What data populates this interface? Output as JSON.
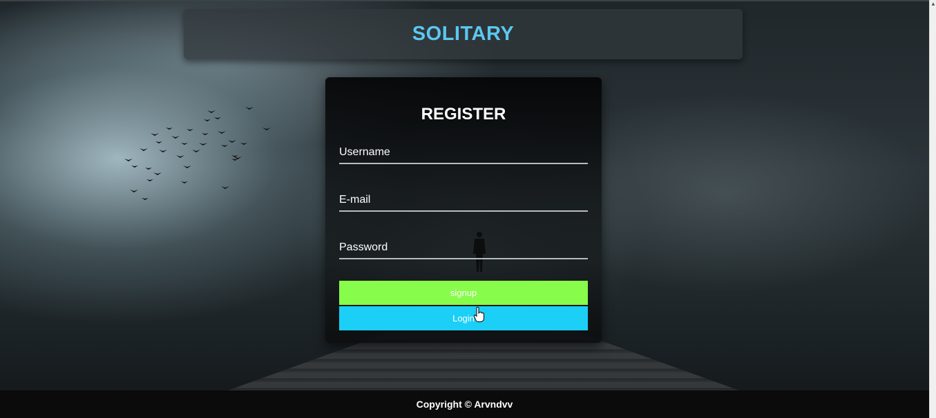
{
  "header": {
    "title": "SOLITARY"
  },
  "form": {
    "title": "REGISTER",
    "username_placeholder": "Username",
    "email_placeholder": "E-mail",
    "password_placeholder": "Password",
    "signup_label": "signup",
    "login_label": "Login"
  },
  "footer": {
    "copyright": "Copyright © Arvndvv"
  },
  "colors": {
    "title": "#5bc8f0",
    "signup": "#88fc4a",
    "login": "#1ccff7"
  }
}
